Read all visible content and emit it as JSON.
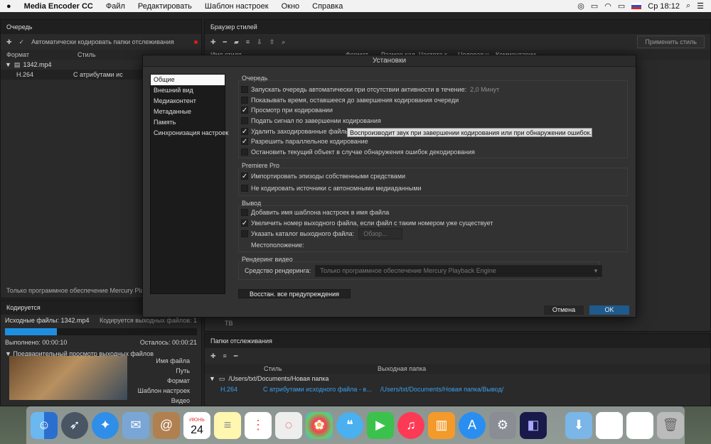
{
  "menubar": {
    "app": "Media Encoder CC",
    "items": [
      "Файл",
      "Редактировать",
      "Шаблон настроек",
      "Окно",
      "Справка"
    ],
    "clock": "Ср 18:12"
  },
  "queue": {
    "title": "Очередь",
    "auto_watch": "Автоматически кодировать папки отслеживания",
    "col_format": "Формат",
    "col_style": "Стиль",
    "file": "1342.mp4",
    "codec": "H.264",
    "preset": "С атрибутами ис",
    "renderer": "Только программное обеспечение Mercury Playback"
  },
  "styles": {
    "title": "Браузер стилей",
    "apply": "Применить стиль",
    "cols": [
      "Имя стиля",
      "Формат",
      "Размер кад",
      "Частота к",
      "Целевая ч.",
      "Комментарии"
    ],
    "tv": "ТВ"
  },
  "encoding": {
    "title": "Кодируется",
    "source_label": "Исходные файлы: 1342.mp4",
    "encoding_label": "Кодируется выходных файлов: 1",
    "progress": 0.27,
    "elapsed": "Выполнено: 00:00:10",
    "remaining": "Осталось: 00:00:21",
    "preview": "Предварительный просмотр выходных файлов",
    "fields": [
      "Имя файла",
      "Путь",
      "Формат",
      "Шаблон настроек",
      "Видео"
    ]
  },
  "watch": {
    "title": "Папки отслеживания",
    "col_style": "Стиль",
    "col_out": "Выходная папка",
    "folder": "/Users/txt/Documents/Новая папка",
    "codec": "H.264",
    "preset": "С атрибутами исходного файла - в...",
    "out": "/Users/txt/Documents/Новая папка/Вывод/"
  },
  "dialog": {
    "title": "Установки",
    "nav": [
      "Общие",
      "Внешний вид",
      "Медиаконтент",
      "Метаданные",
      "Память",
      "Синхронизация настроек"
    ],
    "g1": "Очередь",
    "q": [
      {
        "t": "Запускать очередь автоматически при отсутствии активности в течение:",
        "c": false
      },
      {
        "t": "Показывать время, оставшееся до завершения кодирования очереди",
        "c": false
      },
      {
        "t": "Просмотр при кодировании",
        "c": true
      },
      {
        "t": "Подать сигнал по завершении кодирования",
        "c": false
      },
      {
        "t": "Удалить заходированные файлы из о",
        "c": true
      },
      {
        "t": "Разрешить параллельное кодирование",
        "c": true
      },
      {
        "t": "Остановить текущий объект в случае обнаружения ошибок декодирования",
        "c": false
      }
    ],
    "minutes": "2,0 Минут",
    "tooltip": "Воспроизводит звук при завершении кодирования или при обнаружении ошибок.",
    "g2": "Premiere Pro",
    "p": [
      {
        "t": "Импортировать эпизоды собственными средствами",
        "c": true
      },
      {
        "t": "Не кодировать источники с автономными медиаданными",
        "c": false
      }
    ],
    "g3": "Вывод",
    "o": [
      {
        "t": "Добавить имя шаблона настроек в имя файла",
        "c": false
      },
      {
        "t": "Увеличить номер выходного файла, если файл с таким номером уже существует",
        "c": true
      },
      {
        "t": "Указать каталог выходного файла:",
        "c": false
      }
    ],
    "browse": "Обзор...",
    "location": "Местоположение:",
    "g4": "Рендеринг видео",
    "renderer_label": "Средство рендеринга:",
    "renderer": "Только программное обеспечение Mercury Playback Engine",
    "reset": "Восстан. все предупреждения",
    "cancel": "Отмена",
    "ok": "OK"
  },
  "dock": {
    "calendar_month": "ИЮНЬ",
    "calendar_day": "24"
  }
}
